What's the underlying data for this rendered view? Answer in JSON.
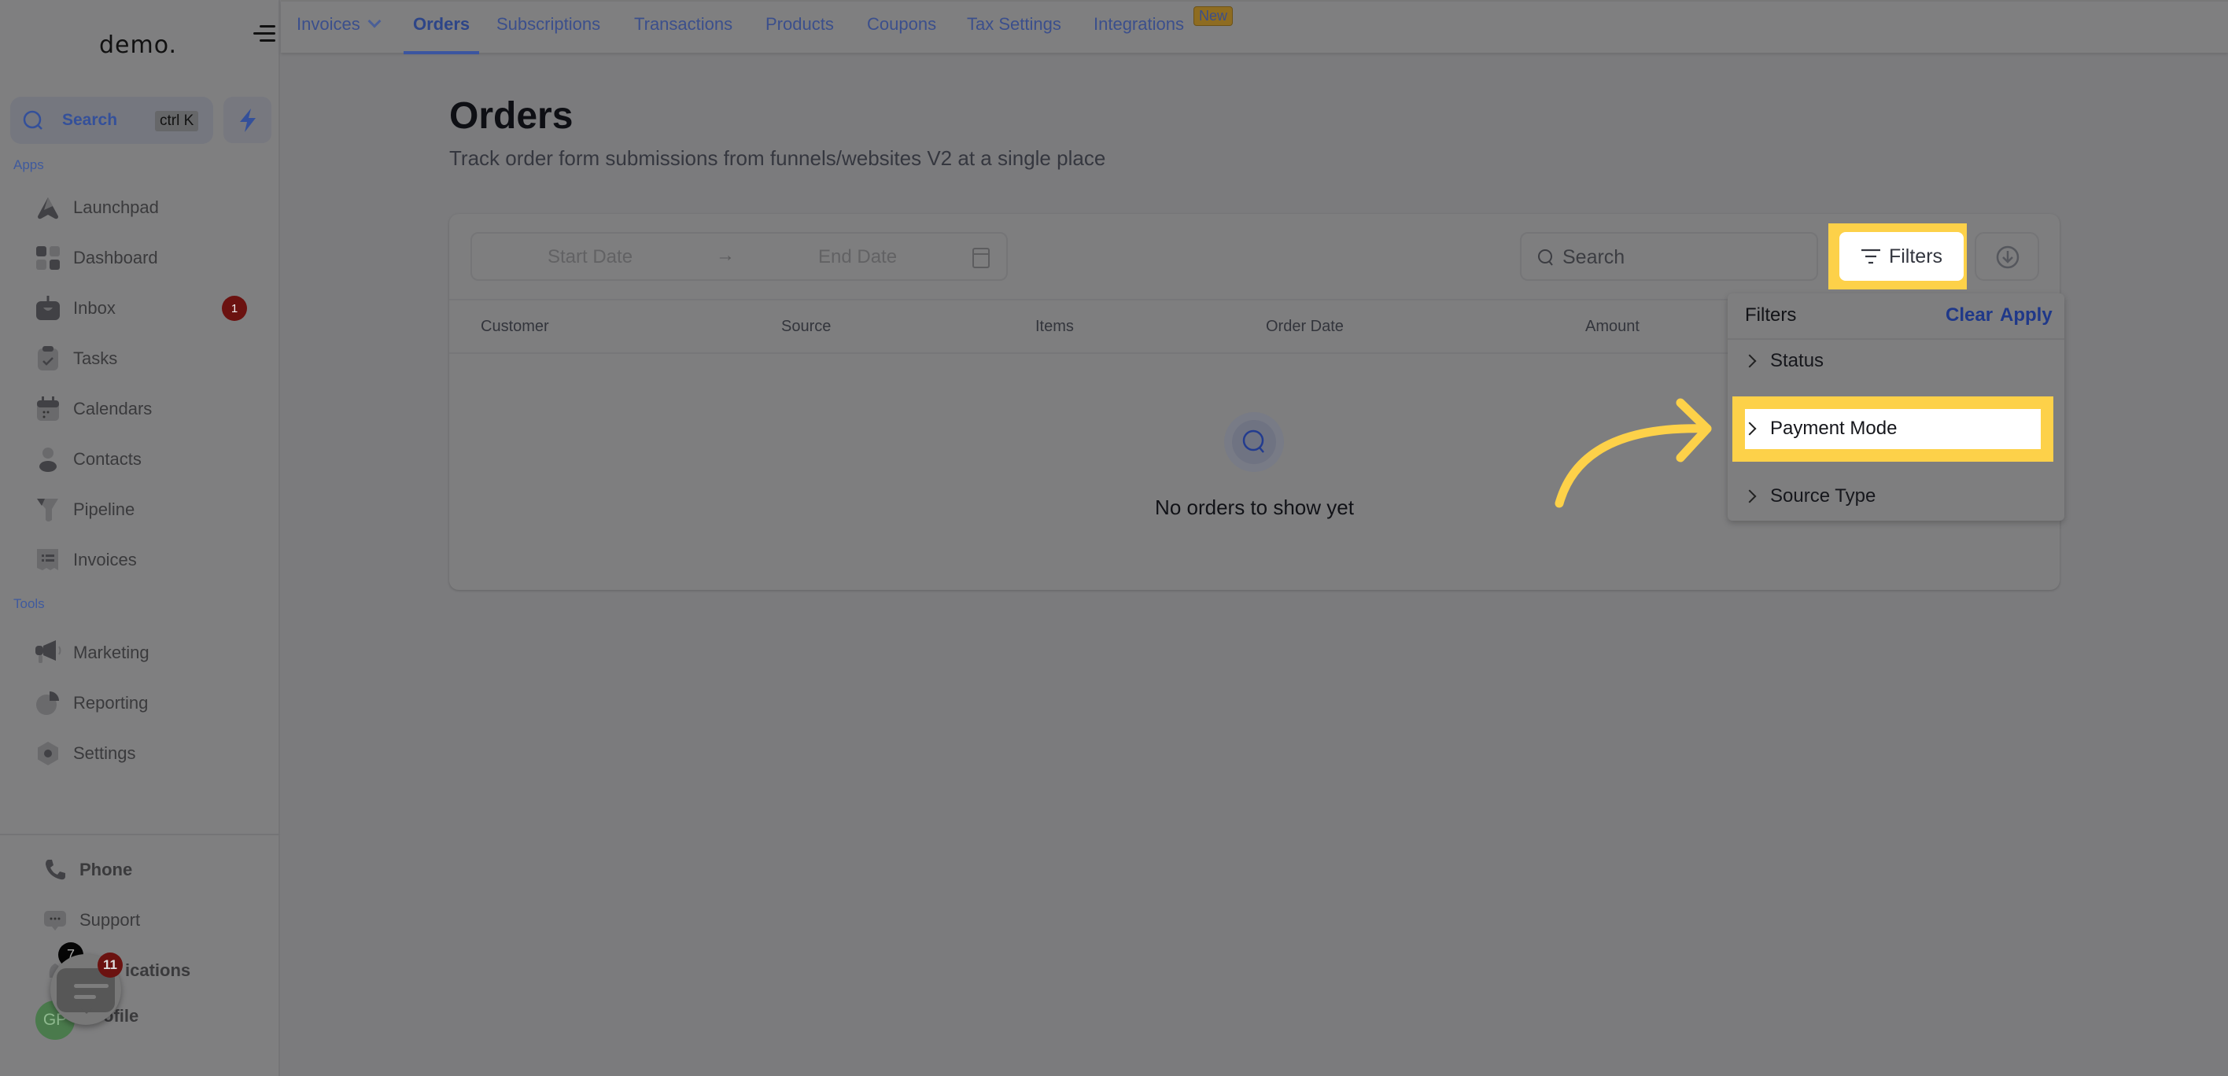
{
  "sidebar": {
    "logo": "demo.",
    "search": {
      "label": "Search",
      "shortcut": "ctrl K"
    },
    "apps_label": "Apps",
    "apps": [
      {
        "label": "Launchpad",
        "icon": "launchpad-icon"
      },
      {
        "label": "Dashboard",
        "icon": "dashboard-icon"
      },
      {
        "label": "Inbox",
        "icon": "inbox-icon",
        "badge": "1"
      },
      {
        "label": "Tasks",
        "icon": "tasks-icon"
      },
      {
        "label": "Calendars",
        "icon": "calendar-icon"
      },
      {
        "label": "Contacts",
        "icon": "contacts-icon"
      },
      {
        "label": "Pipeline",
        "icon": "pipeline-icon"
      },
      {
        "label": "Invoices",
        "icon": "invoices-icon"
      }
    ],
    "tools_label": "Tools",
    "tools": [
      {
        "label": "Marketing",
        "icon": "megaphone-icon"
      },
      {
        "label": "Reporting",
        "icon": "pie-chart-icon"
      },
      {
        "label": "Settings",
        "icon": "settings-icon"
      }
    ],
    "bottom": [
      {
        "label": "Phone",
        "icon": "phone-icon"
      },
      {
        "label": "Support",
        "icon": "support-chat-icon"
      },
      {
        "label": "Notifications",
        "visible_label": "ications",
        "icon": "bell-icon",
        "badge": "7"
      },
      {
        "label": "Profile",
        "visible_label": "ofile",
        "avatar_initials": "GP"
      }
    ],
    "chat_widget_badge": "11"
  },
  "topnav": {
    "tabs": [
      {
        "label": "Invoices",
        "has_dropdown": true
      },
      {
        "label": "Orders",
        "active": true
      },
      {
        "label": "Subscriptions"
      },
      {
        "label": "Transactions"
      },
      {
        "label": "Products"
      },
      {
        "label": "Coupons"
      },
      {
        "label": "Tax Settings"
      },
      {
        "label": "Integrations",
        "badge": "New"
      }
    ]
  },
  "main": {
    "title": "Orders",
    "subtitle": "Track order form submissions from funnels/websites V2 at a single place",
    "toolbar": {
      "start_date_placeholder": "Start Date",
      "end_date_placeholder": "End Date",
      "date_arrow": "→",
      "search_placeholder": "Search",
      "filters_label": "Filters"
    },
    "table": {
      "columns": [
        "Customer",
        "Source",
        "Items",
        "Order Date",
        "Amount"
      ],
      "rows": [],
      "empty_message": "No orders to show yet"
    }
  },
  "filters_panel": {
    "title": "Filters",
    "clear_label": "Clear",
    "apply_label": "Apply",
    "options": [
      "Status",
      "Payment Mode",
      "Source Type"
    ],
    "highlighted_option": "Payment Mode"
  },
  "colors": {
    "highlight": "#fdd149",
    "accent": "#3b55a0",
    "badge_red": "#6b1210"
  }
}
